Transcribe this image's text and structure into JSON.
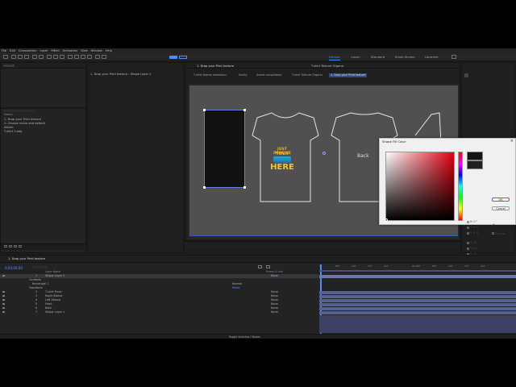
{
  "menu": [
    "File",
    "Edit",
    "Composition",
    "Layer",
    "Effect",
    "Animation",
    "View",
    "Window",
    "Help"
  ],
  "workspaces": [
    "Default",
    "Learn",
    "Standard",
    "Small Screen",
    "Libraries"
  ],
  "project_panel": {
    "header": "1. Drop your Print texture › Shape Layer 2",
    "items": [
      "1. Drop your Print texture",
      "2. Choose name and default",
      "Album",
      "T-shirt 3.aep"
    ]
  },
  "viewer": {
    "tabs": [
      "1. Drop your Print texture",
      "T-shirt Texture Organic"
    ],
    "breadcrumbs": [
      "1. Drop your Print texture",
      "T-shirt Texture Organic"
    ],
    "crumbs": [
      "T-shirt theme animation",
      "Sanity",
      "Scene compilation",
      "T-shirt Texture Organic",
      "1. Drop your Print texture"
    ],
    "back_label": "Back",
    "shirt_text": {
      "line1": "JUST IMAGINE",
      "line2": "YOUR BRAND",
      "line3": "HERE"
    }
  },
  "dialog": {
    "title": "Shape Fill Color",
    "ok": "OK",
    "cancel": "Cancel",
    "fields": {
      "h": "H: 0 °",
      "s": "S: 0 %",
      "b": "B: 8 %",
      "r": "R: 20",
      "g": "G: 20",
      "bl": "B: 20",
      "hex": "# 141414"
    },
    "preview_label": "Preview",
    "new_color": "#141414",
    "old_color": "#202020"
  },
  "timeline": {
    "tab": "1. Drop your Print texture",
    "timecode": "0;00;00;00",
    "column_layer_name": "Layer Name",
    "column_parent": "Parent & Link",
    "rows": [
      {
        "num": "1",
        "name": "Shape Layer 2",
        "parent": "None"
      },
      {
        "num": "",
        "name": "Contents",
        "parent": ""
      },
      {
        "num": "",
        "name": "Rectangle 1",
        "parent": "Normal"
      },
      {
        "num": "",
        "name": "Transform",
        "parent": "Reset"
      },
      {
        "num": "2",
        "name": "T-shirt Front",
        "parent": "None"
      },
      {
        "num": "3",
        "name": "Right Sleeve",
        "parent": "None"
      },
      {
        "num": "4",
        "name": "Left Sleeve",
        "parent": "None"
      },
      {
        "num": "5",
        "name": "Front",
        "parent": "None"
      },
      {
        "num": "6",
        "name": "Back",
        "parent": "None"
      },
      {
        "num": "7",
        "name": "Shape Layer 1",
        "parent": "None"
      }
    ],
    "ruler": [
      "0f",
      "05f",
      "10f",
      "15f",
      "20f",
      "01:00f",
      "05f",
      "10f",
      "15f",
      "20f"
    ],
    "footer": "Toggle Switches / Modes"
  }
}
